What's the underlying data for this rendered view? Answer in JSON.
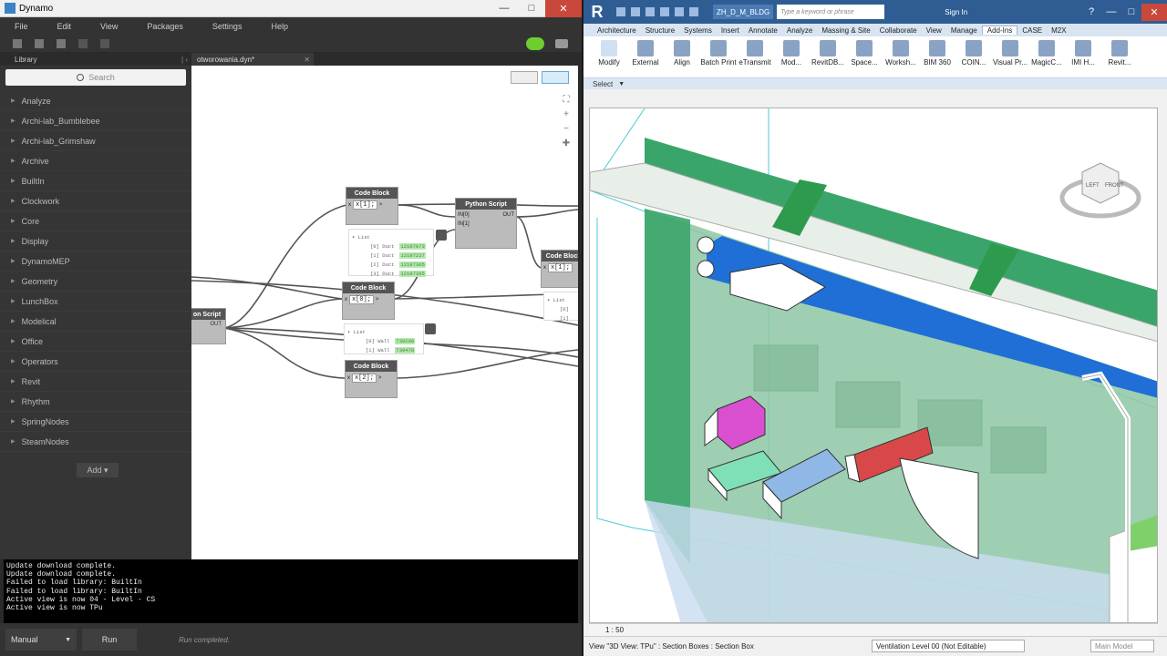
{
  "dynamo": {
    "title": "Dynamo",
    "menu": [
      "File",
      "Edit",
      "View",
      "Packages",
      "Settings",
      "Help"
    ],
    "library": {
      "header": "Library",
      "search_placeholder": "Search",
      "items": [
        "Analyze",
        "Archi-lab_Bumblebee",
        "Archi-lab_Grimshaw",
        "Archive",
        "BuiltIn",
        "Clockwork",
        "Core",
        "Display",
        "DynamoMEP",
        "Geometry",
        "LunchBox",
        "Modelical",
        "Office",
        "Operators",
        "Revit",
        "Rhythm",
        "SpringNodes",
        "SteamNodes"
      ],
      "add_label": "Add"
    },
    "tab": "otworowania.dyn*",
    "nodes": {
      "python_left": {
        "title": "on Script",
        "out": "OUT"
      },
      "code1": {
        "title": "Code Block",
        "code": "x[1];"
      },
      "python_mid": {
        "title": "Python Script",
        "in0": "IN[0]",
        "in1": "IN[1]",
        "out": "OUT"
      },
      "code0": {
        "title": "Code Block",
        "code": "x[0];"
      },
      "code2": {
        "title": "Code Block",
        "code": "x[2];"
      },
      "code_right": {
        "title": "Code Block",
        "code": "x[1];"
      }
    },
    "previews": {
      "duct": {
        "head": "List",
        "rows": [
          {
            "k": "[0] Duct",
            "v": "12197073"
          },
          {
            "k": "[1] Duct",
            "v": "12197227"
          },
          {
            "k": "[2] Duct",
            "v": "12197305"
          },
          {
            "k": "[3] Duct",
            "v": "12197365"
          }
        ]
      },
      "wall": {
        "head": "List",
        "rows": [
          {
            "k": "[0] Wall",
            "v": "739200"
          },
          {
            "k": "[1] Wall",
            "v": "739478"
          }
        ]
      },
      "right": {
        "head": "List",
        "rows": [
          {
            "k": "[0]",
            "v": ""
          },
          {
            "k": "[1]",
            "v": ""
          }
        ]
      }
    },
    "console": [
      "Update download complete.",
      "Update download complete.",
      "Failed to load library: BuiltIn",
      "Failed to load library: BuiltIn",
      "Active view is now 04 - Level - CS",
      "Active view is now TPu"
    ],
    "run_mode": "Manual",
    "run_label": "Run",
    "run_status": "Run completed."
  },
  "revit": {
    "file": "ZH_D_M_BLDG",
    "search_placeholder": "Type a keyword or phrase",
    "signin": "Sign In",
    "tabs": [
      "Architecture",
      "Structure",
      "Systems",
      "Insert",
      "Annotate",
      "Analyze",
      "Massing & Site",
      "Collaborate",
      "View",
      "Manage",
      "Add-Ins",
      "CASE",
      "M2X"
    ],
    "active_tab": "Add-Ins",
    "ribbon_buttons": [
      "Modify",
      "External",
      "Align",
      "Batch Print",
      "eTransmit",
      "Mod...",
      "RevitDB...",
      "Space...",
      "Worksh...",
      "BIM 360",
      "COIN...",
      "Visual Pr...",
      "MagicC...",
      "IMI H...",
      "Revit..."
    ],
    "panel_label": "Select",
    "viewcube_left": "LEFT",
    "viewcube_front": "FRONT",
    "scale": "1 : 50",
    "status": "View \"3D View: TPu\" : Section Boxes : Section Box",
    "level": "Ventilation Level 00 (Not Editable)",
    "model": "Main Model"
  },
  "colors": {
    "dyn_bg": "#2a2a2a",
    "wall_green": "#3aa56a",
    "duct_blue": "#1f6fd6",
    "magenta": "#d94fd0",
    "red": "#d84848",
    "mint": "#7fe0b8",
    "lightblue": "#8fb8e6"
  }
}
